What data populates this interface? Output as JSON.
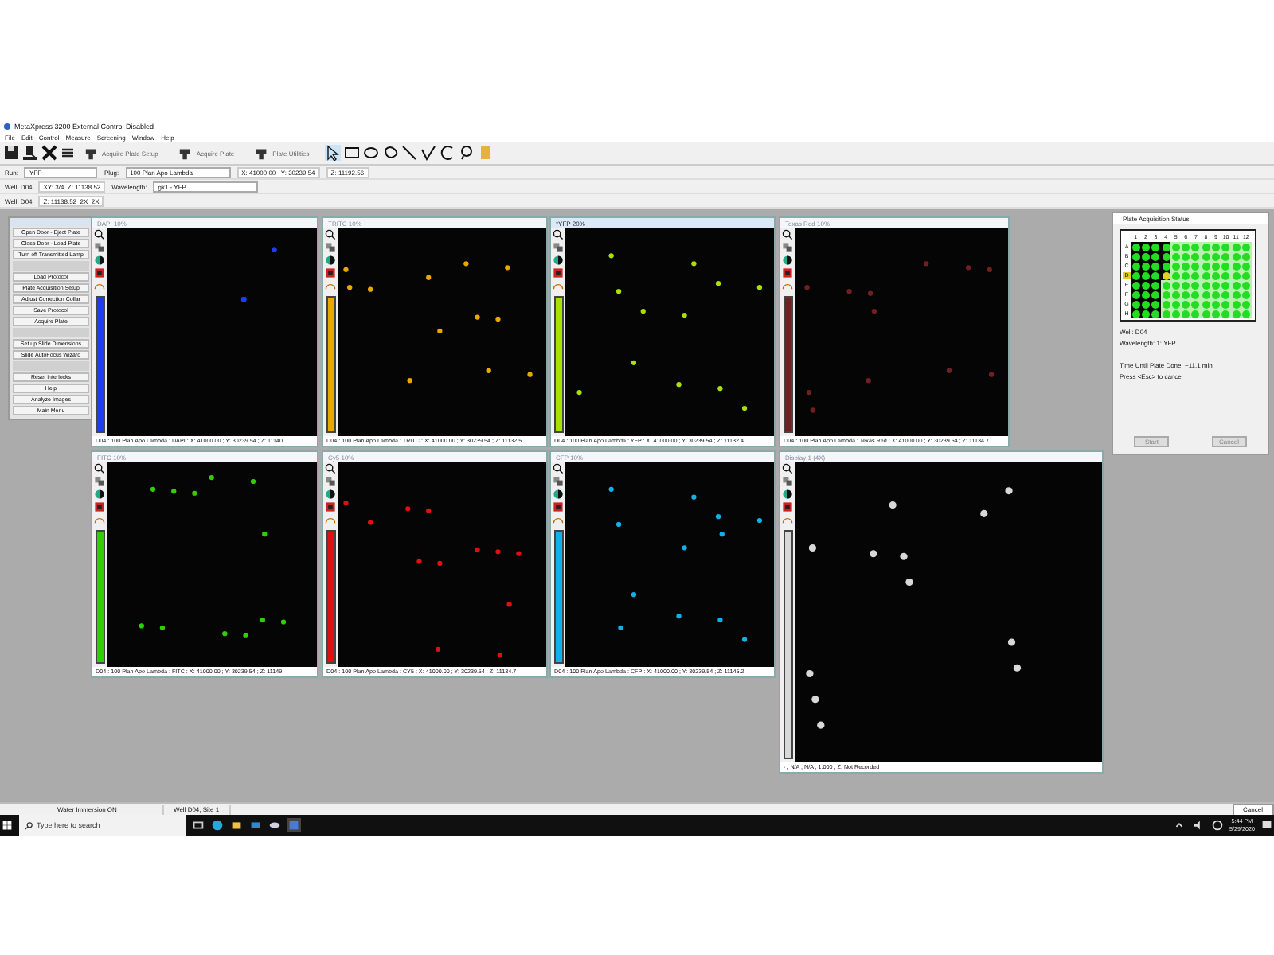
{
  "app": {
    "title": "MetaXpress 3200 External Control Disabled"
  },
  "menu": [
    "File",
    "Edit",
    "Control",
    "Measure",
    "Screening",
    "Window",
    "Help"
  ],
  "toolbar": {
    "buttons": [
      "Acquire Plate Setup",
      "Acquire Plate",
      "Plate Utilities"
    ]
  },
  "controls": {
    "run_label": "Run:",
    "run_value": "YFP",
    "plug_label": "Plug:",
    "plug_value": "100 Plan Apo Lambda",
    "xy": "X: 41000.00   Y: 30239.54",
    "z_top": "Z: 11192.56",
    "well_top": "Well: D04",
    "xyz": "XY: 3/4  Z: 11138.52",
    "wavelength_label": "Wavelength:",
    "wavelength_value": "gk1 - YFP",
    "well_bottom": "Well: D04",
    "z_bottom": "Z: 11138.52  2X  2X"
  },
  "panel": {
    "items": [
      {
        "kind": "button",
        "label": "Open Door - Eject Plate"
      },
      {
        "kind": "button",
        "label": "Close Door - Load Plate"
      },
      {
        "kind": "button",
        "label": "Turn off Transmitted Lamp"
      },
      {
        "kind": "separator"
      },
      {
        "kind": "button",
        "label": "Load Protocol"
      },
      {
        "kind": "button",
        "label": "Plate Acquisition Setup"
      },
      {
        "kind": "button",
        "label": "Adjust Correction Collar"
      },
      {
        "kind": "button",
        "label": "Save Protocol"
      },
      {
        "kind": "button",
        "label": "Acquire Plate"
      },
      {
        "kind": "separator"
      },
      {
        "kind": "button",
        "label": "Set up Slide Dimensions"
      },
      {
        "kind": "button",
        "label": "Slide AutoFocus Wizard"
      },
      {
        "kind": "separator"
      },
      {
        "kind": "button",
        "label": "Reset Interlocks"
      },
      {
        "kind": "button",
        "label": "Help"
      },
      {
        "kind": "button",
        "label": "Analyze Images"
      },
      {
        "kind": "button",
        "label": "Main Menu"
      }
    ]
  },
  "image_windows": [
    {
      "title": "DAPI 10%",
      "caption": "D04 : 100 Plan Apo Lambda : DAPI : X: 41000.00 ; Y: 30239.54 ; Z: 11140",
      "color": "#1e3cf0",
      "selected": false
    },
    {
      "title": "TRITC 10%",
      "caption": "D04 : 100 Plan Apo Lambda : TRITC : X: 41000.00 ; Y: 30239.54 ; Z: 11132.5",
      "color": "#e8a800",
      "selected": false
    },
    {
      "title": "*YFP 20%",
      "caption": "D04 : 100 Plan Apo Lambda : YFP : X: 41000.00 ; Y: 30239.54 ; Z: 11132.4",
      "color": "#a8e000",
      "selected": true
    },
    {
      "title": "Texas Red 10%",
      "caption": "D04 : 100 Plan Apo Lambda : Texas Red : X: 41000.00 ; Y: 30239.54 ; Z: 11134.7",
      "color": "#702020",
      "selected": false
    },
    {
      "title": "FITC 10%",
      "caption": "D04 : 100 Plan Apo Lambda : FITC : X: 41000.00 ; Y: 30239.54 ; Z: 11149",
      "color": "#30d000",
      "selected": false
    },
    {
      "title": "Cy5 10%",
      "caption": "D04 : 100 Plan Apo Lambda : CY5 : X: 41000.00 ; Y: 30239.54 ; Z: 11134.7",
      "color": "#e01010",
      "selected": false
    },
    {
      "title": "CFP 10%",
      "caption": "D04 : 100 Plan Apo Lambda : CFP : X: 41000.00 ; Y: 30239.54 ; Z: 11145.2",
      "color": "#10b0e8",
      "selected": false
    },
    {
      "title": "Display 1 (4X)",
      "caption": "- ; N/A ; N/A ; 1.000 ; Z: Not Recorded",
      "color": "#d8d8d8",
      "selected": false
    }
  ],
  "status_dialog": {
    "title": "Plate Acquisition Status",
    "plate": {
      "columns": [
        {
          "label": "1",
          "acquired": true
        },
        {
          "label": "2",
          "acquired": true
        },
        {
          "label": "3",
          "acquired": true
        },
        {
          "label": "4",
          "acquired": false
        },
        {
          "label": "5",
          "acquired": false
        },
        {
          "label": "6",
          "acquired": false
        },
        {
          "label": "7",
          "acquired": false
        },
        {
          "label": "8",
          "acquired": false
        },
        {
          "label": "9",
          "acquired": false
        },
        {
          "label": "10",
          "acquired": false
        },
        {
          "label": "11",
          "acquired": false
        },
        {
          "label": "12",
          "acquired": false
        }
      ],
      "rows": [
        {
          "label": "A",
          "selected": false
        },
        {
          "label": "B",
          "selected": false
        },
        {
          "label": "C",
          "selected": false
        },
        {
          "label": "D",
          "selected": true
        },
        {
          "label": "E",
          "selected": false
        },
        {
          "label": "F",
          "selected": false
        },
        {
          "label": "G",
          "selected": false
        },
        {
          "label": "H",
          "selected": false
        }
      ]
    },
    "well": "Well: D04",
    "wavelength": "Wavelength: 1: YFP",
    "time_left": "Time Until Plate Done: ~11.1 min",
    "hint": "Press <Esc> to cancel",
    "buttons": [
      {
        "label": "Start",
        "disabled": true
      },
      {
        "label": "Cancel",
        "disabled": true
      }
    ]
  },
  "status_bar": [
    "Water Immersion ON",
    "Well D04, Site 1",
    "Cancel"
  ],
  "taskbar": {
    "search_placeholder": "Type here to search",
    "time": "5:44 PM",
    "date": "5/29/2020"
  }
}
